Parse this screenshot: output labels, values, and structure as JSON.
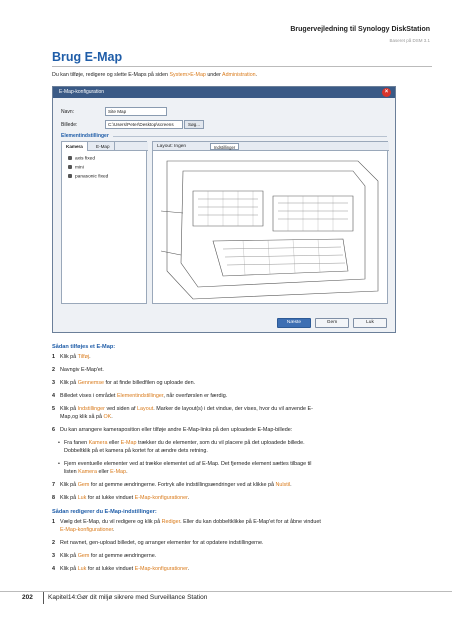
{
  "header": {
    "title": "Brugervejledning til Synology DiskStation",
    "subtitle": "Baseret på DSM 3.1"
  },
  "heading": "Brug E-Map",
  "intro": {
    "pre": "Du kan tilføje, redigere og slette E-Maps på siden ",
    "link": "System>E-Map",
    "mid": " under ",
    "link2": "Administration",
    "post": "."
  },
  "dialog": {
    "title": "E-Map-konfiguration",
    "name_label": "Navn:",
    "name_value": "Site Map",
    "image_label": "Billede:",
    "image_value": "C:\\Users\\Peter\\Desktop\\screens",
    "browse_label": "Søg...",
    "elements_heading": "Elementindstillinger",
    "tab_camera": "Kamera",
    "tab_emap": "E-Map",
    "cameras": [
      "axis fixed",
      "mini",
      "panasonic fixed"
    ],
    "layout_label": "Layout: Ingen",
    "settings_label": "Indstillinger",
    "btn_next": "Næste",
    "btn_save": "Gem",
    "btn_close": "Luk"
  },
  "add_section": {
    "heading": "Sådan tilføjes et E-Map:",
    "steps": [
      {
        "n": "1",
        "pre": "Klik på ",
        "hl": "Tilføj",
        "post": "."
      },
      {
        "n": "2",
        "pre": "Navngiv E-Map'et.",
        "hl": "",
        "post": ""
      },
      {
        "n": "3",
        "pre": "Klik på ",
        "hl": "Gennemse",
        "post": " for at finde billedfilen og uploade den."
      },
      {
        "n": "4",
        "pre": "Billedet vises i området ",
        "hl": "Elementindstillinger",
        "post": ", når overførslen er færdig."
      },
      {
        "n": "5",
        "pre": "Klik på ",
        "hl": "Indstillinger",
        "post": " ved siden af ",
        "hl2": "Layout",
        "post2": ". Marker de layout(s) i det vindue, der vises, hvor du vil anvende E-",
        "line2": "Map,og klik så på ",
        "hl3": "OK",
        "post3": "."
      },
      {
        "n": "6",
        "pre": "Du kan arrangere kameraposition eller tilføje andre E-Map-links på den uploadede E-Map-billede:",
        "hl": "",
        "post": ""
      }
    ],
    "bullets": [
      {
        "pre": "Fra fanen ",
        "hl": "Kamera",
        "mid": " eller ",
        "hl2": "E-Map",
        "post": " trækker du de elementer, som du vil placere på det uploadede billede.",
        "line2": "Dobbeltklik på et kamera på kortet for at ændre dets retning."
      },
      {
        "pre": "Fjern eventuelle elementer ved at trække elementet ud af E-Map. Det fjernede element sættes tilbage til",
        "line2pre": "listen ",
        "hl": "Kamera",
        "mid": " eller ",
        "hl2": "E-Map",
        "post": "."
      }
    ],
    "steps_after": [
      {
        "n": "7",
        "pre": "Klik på ",
        "hl": "Gem",
        "post": " for at gemme ændringerne. Fortryk alle indstillingsændringer ved at klikke på ",
        "hl2": "Nulstil",
        "post2": "."
      },
      {
        "n": "8",
        "pre": "Klik på ",
        "hl": "Luk",
        "post": " for at lukke vinduet ",
        "hl2": "E-Map-konfigurationer",
        "post2": "."
      }
    ]
  },
  "edit_section": {
    "heading": "Sådan redigerer du E-Map-indstillinger:",
    "steps": [
      {
        "n": "1",
        "pre": "Vælg det E-Map, du vil redigere og klik på ",
        "hl": "Rediger",
        "post": ". Eller du kan dobbeltklikke på E-Map'et for at åbne vinduet",
        "line2": "E-Map-konfigurationer",
        "post2": "."
      },
      {
        "n": "2",
        "pre": "Ret navnet, gen-upload billedet, og arranger elementer for at opdatere indstillingerne.",
        "hl": "",
        "post": ""
      },
      {
        "n": "3",
        "pre": "Klik på ",
        "hl": "Gem",
        "post": " for at gemme ændringerne."
      },
      {
        "n": "4",
        "pre": "Klik på ",
        "hl": "Luk",
        "post": " for at lukke vinduet ",
        "hl2": "E-Map-konfigurationer",
        "post2": "."
      }
    ]
  },
  "footer": {
    "page": "202",
    "chapter": "Kapitel14:Gør dit miljø sikrere med Surveillance Station"
  }
}
